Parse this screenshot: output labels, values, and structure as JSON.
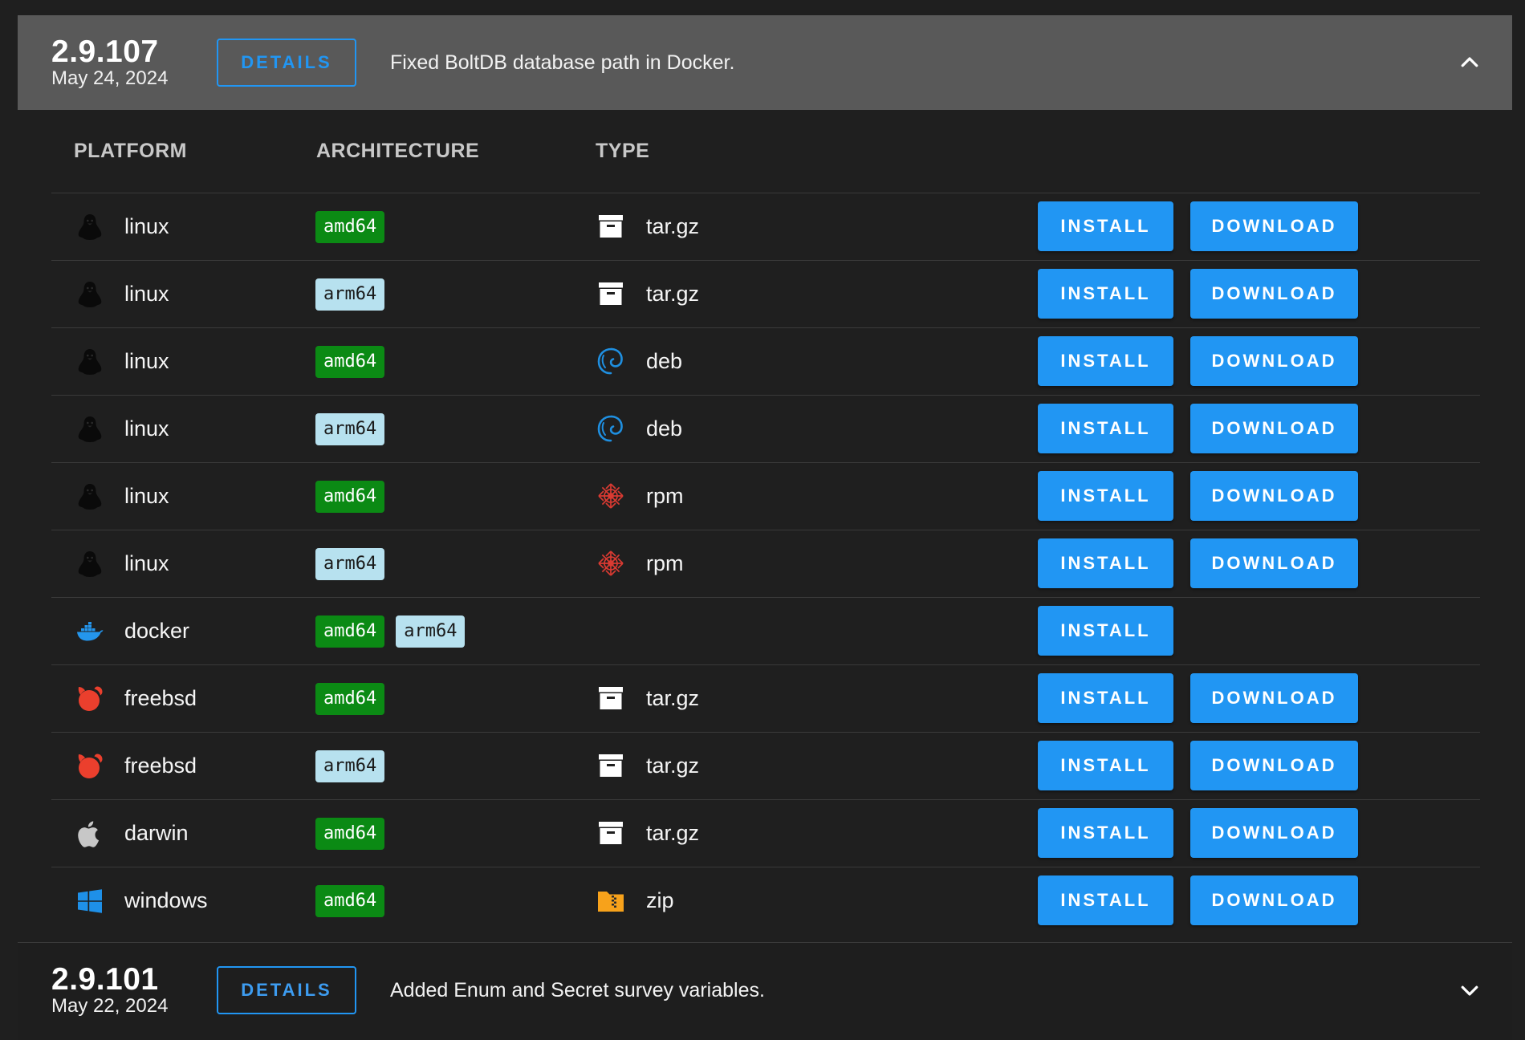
{
  "headers": {
    "platform": "PLATFORM",
    "architecture": "ARCHITECTURE",
    "type": "TYPE"
  },
  "buttons": {
    "details": "DETAILS",
    "install": "INSTALL",
    "download": "DOWNLOAD"
  },
  "colors": {
    "accent": "#2196f3",
    "amd64_chip": "#0b8a14",
    "arm64_chip": "#b7e1ef",
    "header_expanded": "#595959",
    "background": "#1f1f1f"
  },
  "releases": [
    {
      "version": "2.9.107",
      "date": "May 24, 2024",
      "summary": "Fixed BoltDB database path in Docker.",
      "expanded": true,
      "toggle_icon": "chevron-up-icon"
    },
    {
      "version": "2.9.101",
      "date": "May 22, 2024",
      "summary": "Added Enum and Secret survey variables.",
      "expanded": false,
      "toggle_icon": "chevron-down-icon"
    }
  ],
  "rows": [
    {
      "platform": "linux",
      "platform_icon": "linux-tux-icon",
      "arch": [
        "amd64"
      ],
      "type": "tar.gz",
      "type_icon": "archive-box-icon",
      "download": true
    },
    {
      "platform": "linux",
      "platform_icon": "linux-tux-icon",
      "arch": [
        "arm64"
      ],
      "type": "tar.gz",
      "type_icon": "archive-box-icon",
      "download": true
    },
    {
      "platform": "linux",
      "platform_icon": "linux-tux-icon",
      "arch": [
        "amd64"
      ],
      "type": "deb",
      "type_icon": "debian-swirl-icon",
      "download": true
    },
    {
      "platform": "linux",
      "platform_icon": "linux-tux-icon",
      "arch": [
        "arm64"
      ],
      "type": "deb",
      "type_icon": "debian-swirl-icon",
      "download": true
    },
    {
      "platform": "linux",
      "platform_icon": "linux-tux-icon",
      "arch": [
        "amd64"
      ],
      "type": "rpm",
      "type_icon": "rpm-package-icon",
      "download": true
    },
    {
      "platform": "linux",
      "platform_icon": "linux-tux-icon",
      "arch": [
        "arm64"
      ],
      "type": "rpm",
      "type_icon": "rpm-package-icon",
      "download": true
    },
    {
      "platform": "docker",
      "platform_icon": "docker-whale-icon",
      "arch": [
        "amd64",
        "arm64"
      ],
      "type": "",
      "type_icon": "",
      "download": false
    },
    {
      "platform": "freebsd",
      "platform_icon": "freebsd-daemon-icon",
      "arch": [
        "amd64"
      ],
      "type": "tar.gz",
      "type_icon": "archive-box-icon",
      "download": true
    },
    {
      "platform": "freebsd",
      "platform_icon": "freebsd-daemon-icon",
      "arch": [
        "arm64"
      ],
      "type": "tar.gz",
      "type_icon": "archive-box-icon",
      "download": true
    },
    {
      "platform": "darwin",
      "platform_icon": "apple-icon",
      "arch": [
        "amd64"
      ],
      "type": "tar.gz",
      "type_icon": "archive-box-icon",
      "download": true
    },
    {
      "platform": "windows",
      "platform_icon": "windows-logo-icon",
      "arch": [
        "amd64"
      ],
      "type": "zip",
      "type_icon": "zip-folder-icon",
      "download": true
    }
  ]
}
